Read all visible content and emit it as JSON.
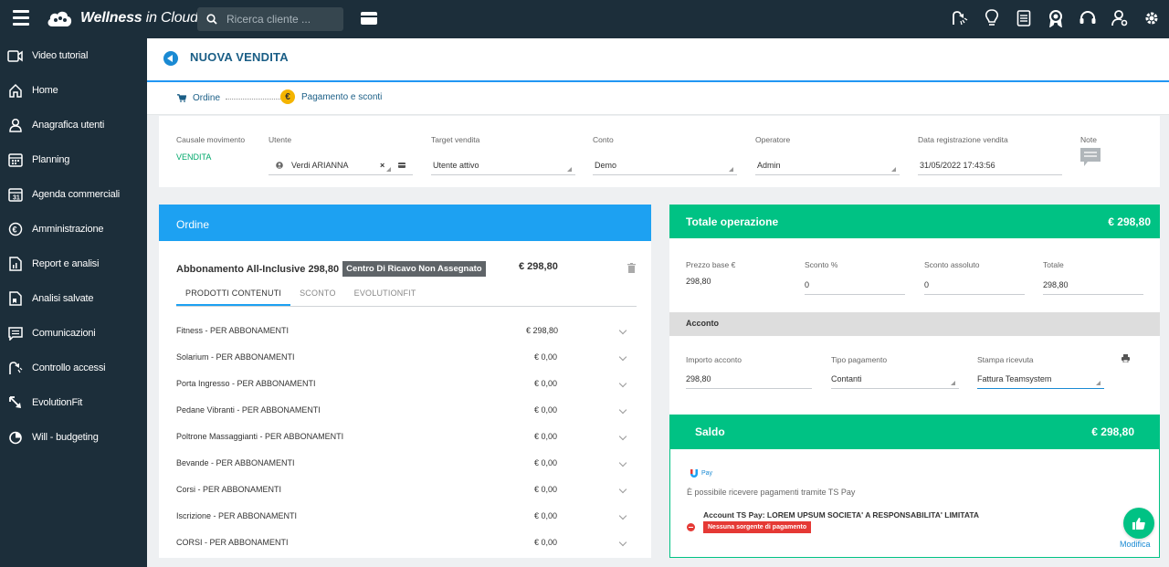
{
  "app": {
    "logo_text_bold": "Wellness",
    "logo_text_light": " in Cloud",
    "search_placeholder": "Ricerca cliente ..."
  },
  "top_icons": [
    "shower-icon",
    "lightbulb-icon",
    "document-icon",
    "award-icon",
    "headset-icon",
    "user-settings-icon",
    "gear-icon"
  ],
  "sidebar": {
    "items": [
      {
        "label": "Video tutorial",
        "icon": "video-icon"
      },
      {
        "label": "Home",
        "icon": "home-icon"
      },
      {
        "label": "Anagrafica utenti",
        "icon": "users-icon"
      },
      {
        "label": "Planning",
        "icon": "calendar-grid-icon"
      },
      {
        "label": "Agenda commerciali",
        "icon": "calendar-icon"
      },
      {
        "label": "Amministrazione",
        "icon": "euro-icon"
      },
      {
        "label": "Report e analisi",
        "icon": "chart-document-icon"
      },
      {
        "label": "Analisi salvate",
        "icon": "saved-document-icon"
      },
      {
        "label": "Comunicazioni",
        "icon": "message-icon"
      },
      {
        "label": "Controllo accessi",
        "icon": "access-icon"
      },
      {
        "label": "EvolutionFit",
        "icon": "arrows-icon"
      },
      {
        "label": "Will - budgeting",
        "icon": "pie-chart-icon"
      }
    ]
  },
  "header": {
    "title": "NUOVA VENDITA"
  },
  "steps": {
    "step1": "Ordine",
    "step2": "Pagamento e sconti",
    "step2_symbol": "€"
  },
  "form": {
    "causale_label": "Causale movimento",
    "causale_value": "VENDITA",
    "utente_label": "Utente",
    "utente_value": "Verdi ARIANNA",
    "target_label": "Target vendita",
    "target_value": "Utente attivo",
    "conto_label": "Conto",
    "conto_value": "Demo",
    "operatore_label": "Operatore",
    "operatore_value": "Admin",
    "data_label": "Data registrazione vendita",
    "data_value": "31/05/2022 17:43:56",
    "note_label": "Note"
  },
  "ordine": {
    "title": "Ordine",
    "product": "Abbonamento All-Inclusive 298,80",
    "badge": "Centro Di Ricavo Non Assegnato",
    "price": "€ 298,80",
    "tabs": [
      "PRODOTTI CONTENUTI",
      "SCONTO",
      "EVOLUTIONFIT"
    ],
    "rows": [
      {
        "name": "Fitness - PER ABBONAMENTI",
        "price": "€ 298,80"
      },
      {
        "name": "Solarium - PER ABBONAMENTI",
        "price": "€ 0,00"
      },
      {
        "name": "Porta Ingresso - PER ABBONAMENTI",
        "price": "€ 0,00"
      },
      {
        "name": "Pedane Vibranti - PER ABBONAMENTI",
        "price": "€ 0,00"
      },
      {
        "name": "Poltrone Massaggianti - PER ABBONAMENTI",
        "price": "€ 0,00"
      },
      {
        "name": "Bevande - PER ABBONAMENTI",
        "price": "€ 0,00"
      },
      {
        "name": "Corsi - PER ABBONAMENTI",
        "price": "€ 0,00"
      },
      {
        "name": "Iscrizione - PER ABBONAMENTI",
        "price": "€ 0,00"
      },
      {
        "name": "CORSI - PER ABBONAMENTI",
        "price": "€ 0,00"
      }
    ]
  },
  "totale": {
    "title": "Totale operazione",
    "amount": "€ 298,80",
    "prezzo_label": "Prezzo base €",
    "prezzo_value": "298,80",
    "sconto_pct_label": "Sconto %",
    "sconto_pct_value": "0",
    "sconto_abs_label": "Sconto assoluto",
    "sconto_abs_value": "0",
    "totale_label": "Totale",
    "totale_value": "298,80",
    "acconto_title": "Acconto",
    "importo_label": "Importo acconto",
    "importo_value": "298,80",
    "tipo_label": "Tipo pagamento",
    "tipo_value": "Contanti",
    "stampa_label": "Stampa ricevuta",
    "stampa_value": "Fattura Teamsystem"
  },
  "saldo": {
    "title": "Saldo",
    "amount": "€ 298,80",
    "tspay_label": "Pay",
    "tspay_info": "È possibile ricevere pagamenti tramite TS Pay",
    "account": "Account TS Pay: LOREM UPSUM SOCIETA' A RESPONSABILITA' LIMITATA",
    "error_badge": "Nessuna sorgente di pagamento"
  },
  "fab": {
    "label": "Modifica"
  },
  "colors": {
    "topbar": "#1c2e3a",
    "accent_blue": "#1da1f2",
    "accent_green": "#00c284",
    "error_red": "#e53935"
  }
}
